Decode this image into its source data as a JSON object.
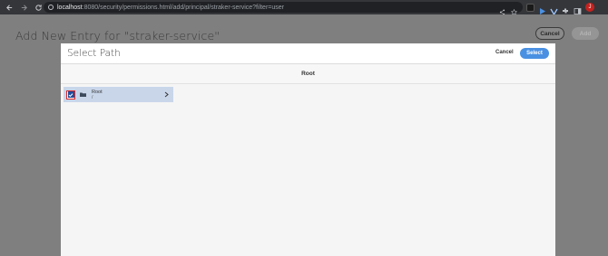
{
  "browser": {
    "url_host": "localhost",
    "url_path": ":8080/security/permissions.html/add/principal/straker-service?filter=user",
    "profile_initial": "J"
  },
  "page": {
    "title": "Add New Entry for \"straker-service\"",
    "cancel_label": "Cancel",
    "add_label": "Add"
  },
  "modal": {
    "title": "Select Path",
    "cancel_label": "Cancel",
    "select_label": "Select",
    "breadcrumb": "Root",
    "items": [
      {
        "name": "Root",
        "path": "/",
        "checked": true
      }
    ]
  },
  "colors": {
    "accent": "#4a90e2",
    "row_selected": "#c9d6ea",
    "checkbox": "#1f4e9c",
    "highlight_border": "#d62b2b"
  }
}
